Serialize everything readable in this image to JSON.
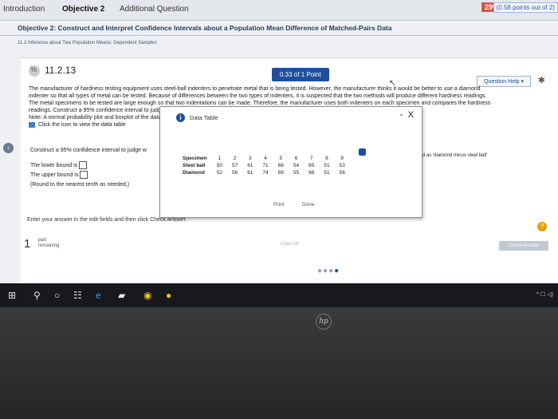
{
  "topbar": {
    "tabs": [
      "Introduction",
      "Objective 2",
      "Additional Question"
    ],
    "score_percent": "29%",
    "score_points": "(0.58 points out of 2)"
  },
  "objective": "Objective 2: Construct and Interpret Confidence Intervals about a Population Mean Difference of Matched-Pairs Data",
  "subtopic": "11.2 Inference about Two Population Means: Dependent Samples",
  "question": {
    "number": "11.2.13",
    "points": "0.33 of 1 Point",
    "help": "Question Help",
    "text_lines": [
      "The manufacturer of hardness testing equipment uses steel-ball indenters to penetrate metal that is being tested. However, the manufacturer thinks it would be better to use a diamond",
      "indenter so that all types of metal can be tested. Because of differences between the two types of indenters, it is suspected that the two methods will produce different hardness readings.",
      "The metal specimens to be tested are large enough so that two indentations can be made. Therefore, the manufacturer uses both indenters on each specimen and compares the hardness",
      "readings. Construct a 95% confidence interval to judge whether the two indenters result in different measurements.",
      "Note: A normal probability plot and boxplot of the data indicate that the differenced data are approximately normally distributed with no outliers."
    ],
    "data_table_link": "Click the icon to view the data table",
    "part_prompt": "Construct a 95% confidence interval to judge w",
    "part_prompt_right": "d as 'diamond minus steel ball'",
    "lower_bound": "The lower bound is",
    "upper_bound": "The upper bound is",
    "round_note": "(Round to the nearest tenth as needed.)",
    "enter_answer": "Enter your answer in the edit fields and then click Check Answer.",
    "check_inline": "click Check Answer",
    "part_count": "1",
    "part_label_1": "part",
    "part_label_2": "remaining",
    "clear_all": "Clear All",
    "check_answer": "Check Answer",
    "hint": "?"
  },
  "dialog": {
    "title": "Data Table",
    "minimize": "-",
    "close": "X",
    "row_headers": [
      "Specimen",
      "Steel ball",
      "Diamond"
    ],
    "specimen": [
      "1",
      "2",
      "3",
      "4",
      "5",
      "6",
      "7",
      "8",
      "9"
    ],
    "steel_ball": [
      "50",
      "57",
      "61",
      "71",
      "68",
      "54",
      "65",
      "51",
      "53"
    ],
    "diamond": [
      "52",
      "56",
      "61",
      "74",
      "69",
      "55",
      "68",
      "51",
      "56"
    ],
    "print": "Print",
    "done": "Done"
  },
  "taskbar": {
    "tray": "^ ☐ ◁)"
  },
  "brand": "hp"
}
